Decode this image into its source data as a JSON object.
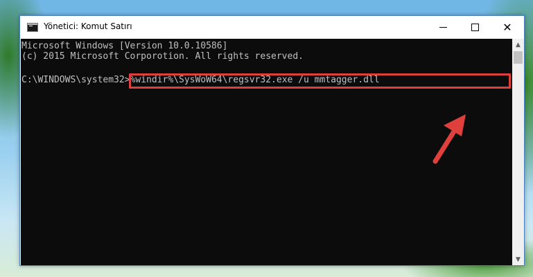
{
  "window": {
    "title": "Yönetici: Komut Satırı",
    "icon": "cmd-icon",
    "controls": {
      "minimize_icon": "minimize-icon",
      "maximize_icon": "maximize-icon",
      "close_icon": "close-icon",
      "close_glyph": "✕"
    }
  },
  "console": {
    "lines": [
      "Microsoft Windows [Version 10.0.10586]",
      "(c) 2015 Microsoft Corporotion. All rights reserved.",
      ""
    ],
    "prompt": "C:\\WINDOWS\\system32>",
    "command": "%windir%\\SysWoW64\\regsvr32.exe /u mmtagger.dll",
    "text_color": "#c0c0c0",
    "background": "#0c0c0c"
  },
  "annotation": {
    "highlight_color": "#e0403c",
    "arrow_color": "#e0403c"
  },
  "scrollbar": {
    "up_glyph": "▲",
    "down_glyph": "▼"
  }
}
